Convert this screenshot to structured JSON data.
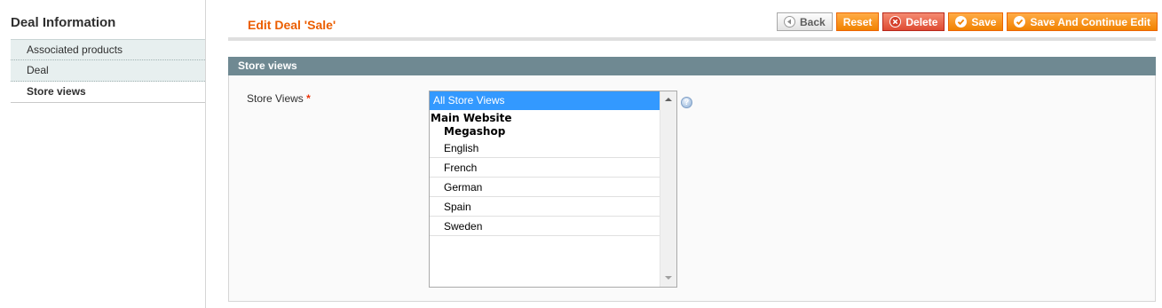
{
  "sidebar": {
    "title": "Deal Information",
    "tabs": [
      {
        "label": "Associated products",
        "active": false
      },
      {
        "label": "Deal",
        "active": false
      },
      {
        "label": "Store views",
        "active": true
      }
    ]
  },
  "header": {
    "title": "Edit Deal 'Sale'",
    "buttons": {
      "back": "Back",
      "reset": "Reset",
      "delete": "Delete",
      "save": "Save",
      "save_continue": "Save And Continue Edit"
    }
  },
  "fieldset": {
    "title": "Store views",
    "field_label": "Store Views",
    "required_mark": "*",
    "help_glyph": "?",
    "options": {
      "all": "All Store Views",
      "website": "Main Website",
      "store": "Megashop",
      "views": [
        "English",
        "French",
        "German",
        "Spain",
        "Sweden"
      ]
    },
    "selected": "All Store Views"
  },
  "colors": {
    "accent": "#eb5e00",
    "button_orange": "#f18200",
    "button_delete": "#de4a32",
    "fieldset_header": "#6f8992",
    "selection": "#3399ff"
  },
  "icons": {
    "back": "back-arrow-icon",
    "delete": "delete-x-icon",
    "save": "checkmark-icon",
    "save_continue": "checkmark-icon",
    "help": "help-icon"
  }
}
